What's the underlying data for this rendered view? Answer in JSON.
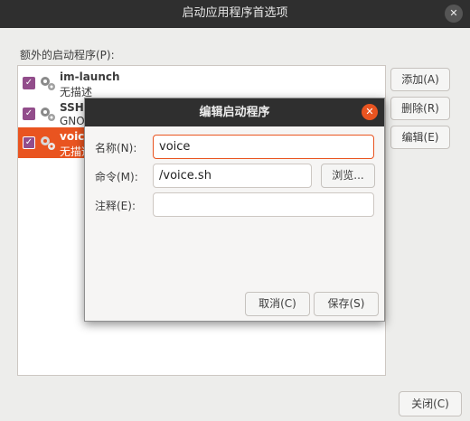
{
  "window": {
    "title": "启动应用程序首选项",
    "close_glyph": "✕"
  },
  "list_label": "额外的启动程序(P):",
  "programs": [
    {
      "name": "im-launch",
      "desc": "无描述",
      "checked": true,
      "selected": false
    },
    {
      "name": "SSH",
      "desc": "GNO",
      "checked": true,
      "selected": false
    },
    {
      "name": "voice",
      "desc": "无描述",
      "checked": true,
      "selected": true
    }
  ],
  "side_buttons": {
    "add": "添加(A)",
    "remove": "删除(R)",
    "edit": "编辑(E)"
  },
  "close_button": "关闭(C)",
  "dialog": {
    "title": "编辑启动程序",
    "close_glyph": "✕",
    "name_label": "名称(N):",
    "name_value": "voice",
    "command_label": "命令(M):",
    "command_value": "/voice.sh",
    "browse_label": "浏览...",
    "comment_label": "注释(E):",
    "comment_value": "",
    "cancel_label": "取消(C)",
    "save_label": "保存(S)"
  },
  "colors": {
    "accent": "#e95420",
    "checkbox": "#924d8b",
    "titlebar": "#2f2f2f"
  },
  "icons": {
    "check": "✓",
    "program": "gears-icon"
  }
}
